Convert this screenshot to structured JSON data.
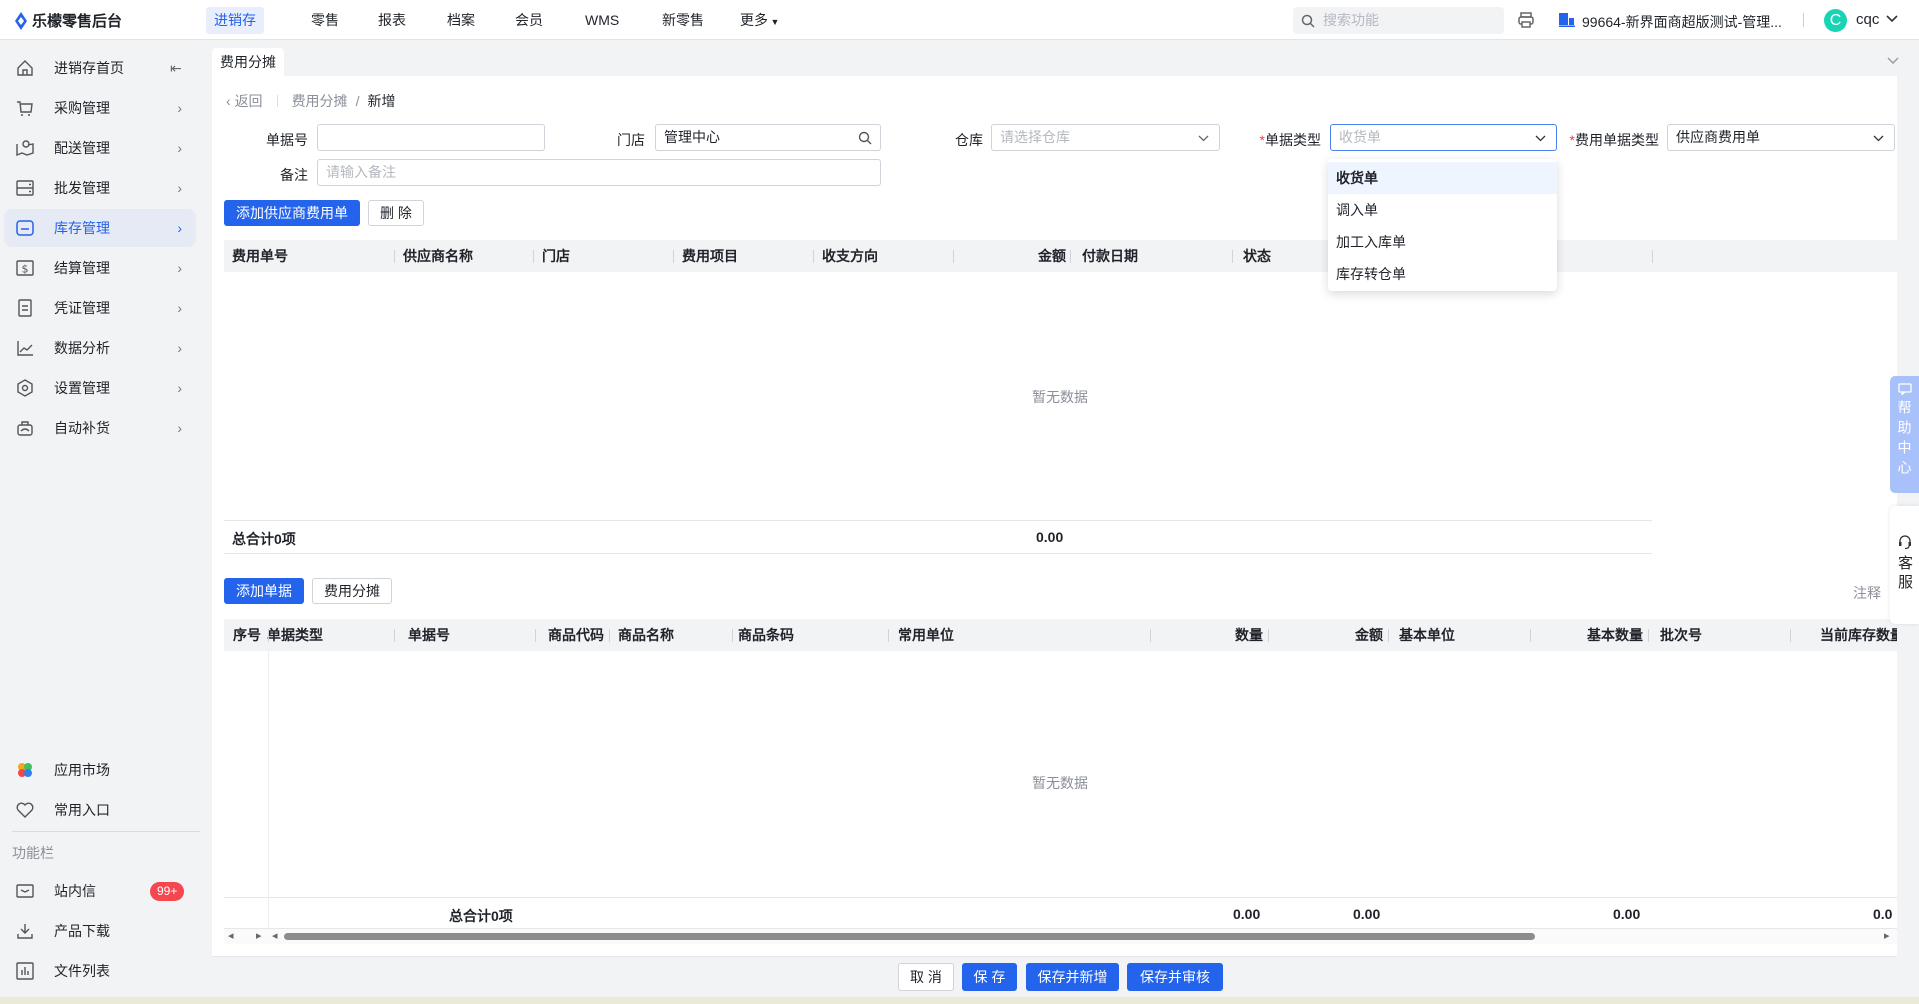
{
  "app": {
    "title": "乐檬零售后台"
  },
  "topnav": [
    {
      "label": "进销存",
      "active": true
    },
    {
      "label": "零售"
    },
    {
      "label": "报表"
    },
    {
      "label": "档案"
    },
    {
      "label": "会员"
    },
    {
      "label": "WMS"
    },
    {
      "label": "新零售"
    },
    {
      "label": "更多"
    }
  ],
  "search": {
    "placeholder": "搜索功能"
  },
  "store": {
    "name": "99664-新界面商超版测试-管理..."
  },
  "user": {
    "avatar": "C",
    "name": "cqc"
  },
  "sidebar": {
    "items": [
      {
        "label": "进销存首页",
        "icon": "home-icon"
      },
      {
        "label": "采购管理",
        "icon": "cart-icon"
      },
      {
        "label": "配送管理",
        "icon": "map-icon"
      },
      {
        "label": "批发管理",
        "icon": "server-icon"
      },
      {
        "label": "库存管理",
        "icon": "inventory-icon",
        "active": true
      },
      {
        "label": "结算管理",
        "icon": "dollar-icon"
      },
      {
        "label": "凭证管理",
        "icon": "document-icon"
      },
      {
        "label": "数据分析",
        "icon": "chart-icon"
      },
      {
        "label": "设置管理",
        "icon": "settings-icon"
      },
      {
        "label": "自动补货",
        "icon": "restock-icon"
      }
    ],
    "bottom": [
      {
        "label": "应用市场"
      },
      {
        "label": "常用入口"
      }
    ],
    "section": "功能栏",
    "tools": [
      {
        "label": "站内信",
        "badge": "99+"
      },
      {
        "label": "产品下载"
      },
      {
        "label": "文件列表"
      }
    ]
  },
  "tab": {
    "label": "费用分摊"
  },
  "breadcrumb": {
    "back": "返回",
    "parent": "费用分摊",
    "current": "新增"
  },
  "form": {
    "doc_no_label": "单据号",
    "doc_no_value": "",
    "store_label": "门店",
    "store_value": "管理中心",
    "warehouse_label": "仓库",
    "warehouse_placeholder": "请选择仓库",
    "doc_type_label": "单据类型",
    "doc_type_placeholder": "收货单",
    "fee_doc_type_label": "费用单据类型",
    "fee_doc_type_value": "供应商费用单",
    "remark_label": "备注",
    "remark_placeholder": "请输入备注"
  },
  "dropdown": {
    "options": [
      "收货单",
      "调入单",
      "加工入库单",
      "库存转仓单"
    ],
    "highlighted": 0
  },
  "table1": {
    "add_button": "添加供应商费用单",
    "delete_button": "删 除",
    "columns": [
      "费用单号",
      "供应商名称",
      "门店",
      "费用项目",
      "收支方向",
      "金额",
      "付款日期",
      "状态"
    ],
    "empty": "暂无数据",
    "total_label": "总合计0项",
    "total_amount": "0.00"
  },
  "table2": {
    "add_button": "添加单据",
    "allocate_button": "费用分摊",
    "note_label": "注释",
    "columns": [
      "序号",
      "单据类型",
      "单据号",
      "商品代码",
      "商品名称",
      "商品条码",
      "常用单位",
      "数量",
      "金额",
      "基本单位",
      "基本数量",
      "批次号",
      "当前库存数量"
    ],
    "empty": "暂无数据",
    "total_label": "总合计0项",
    "totals": [
      "0.00",
      "0.00",
      "0.00",
      "0.0"
    ]
  },
  "footer": {
    "cancel": "取 消",
    "save": "保 存",
    "save_new": "保存并新增",
    "save_audit": "保存并审核"
  },
  "help": {
    "label": "帮助中心",
    "service": "客服"
  }
}
